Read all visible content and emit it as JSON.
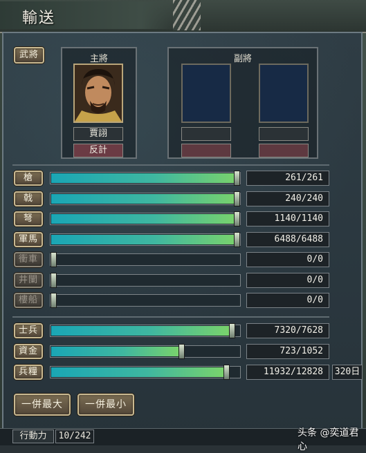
{
  "window": {
    "title": "輸送"
  },
  "general_button": "武將",
  "main_general": {
    "header": "主將",
    "name": "賈詡",
    "skill": "反計"
  },
  "vice_general": {
    "header": "副將"
  },
  "units": [
    {
      "label": "槍",
      "value": "261/261",
      "fill": 1.0,
      "enabled": true
    },
    {
      "label": "戟",
      "value": "240/240",
      "fill": 1.0,
      "enabled": true
    },
    {
      "label": "弩",
      "value": "1140/1140",
      "fill": 1.0,
      "enabled": true
    },
    {
      "label": "軍馬",
      "value": "6488/6488",
      "fill": 1.0,
      "enabled": true
    },
    {
      "label": "衝車",
      "value": "0/0",
      "fill": 0.0,
      "enabled": false
    },
    {
      "label": "井闌",
      "value": "0/0",
      "fill": 0.0,
      "enabled": false
    },
    {
      "label": "樓船",
      "value": "0/0",
      "fill": 0.0,
      "enabled": false
    }
  ],
  "resources": [
    {
      "label": "士兵",
      "value": "7320/7628",
      "fill": 0.96
    },
    {
      "label": "資金",
      "value": "723/1052",
      "fill": 0.69
    },
    {
      "label": "兵糧",
      "value": "11932/12828",
      "fill": 0.93,
      "extra": "320日"
    }
  ],
  "actions": {
    "max_all": "一併最大",
    "min_all": "一併最小"
  },
  "status": {
    "label": "行動力",
    "value": "10/242"
  },
  "watermark": "头条 @奕道君心"
}
